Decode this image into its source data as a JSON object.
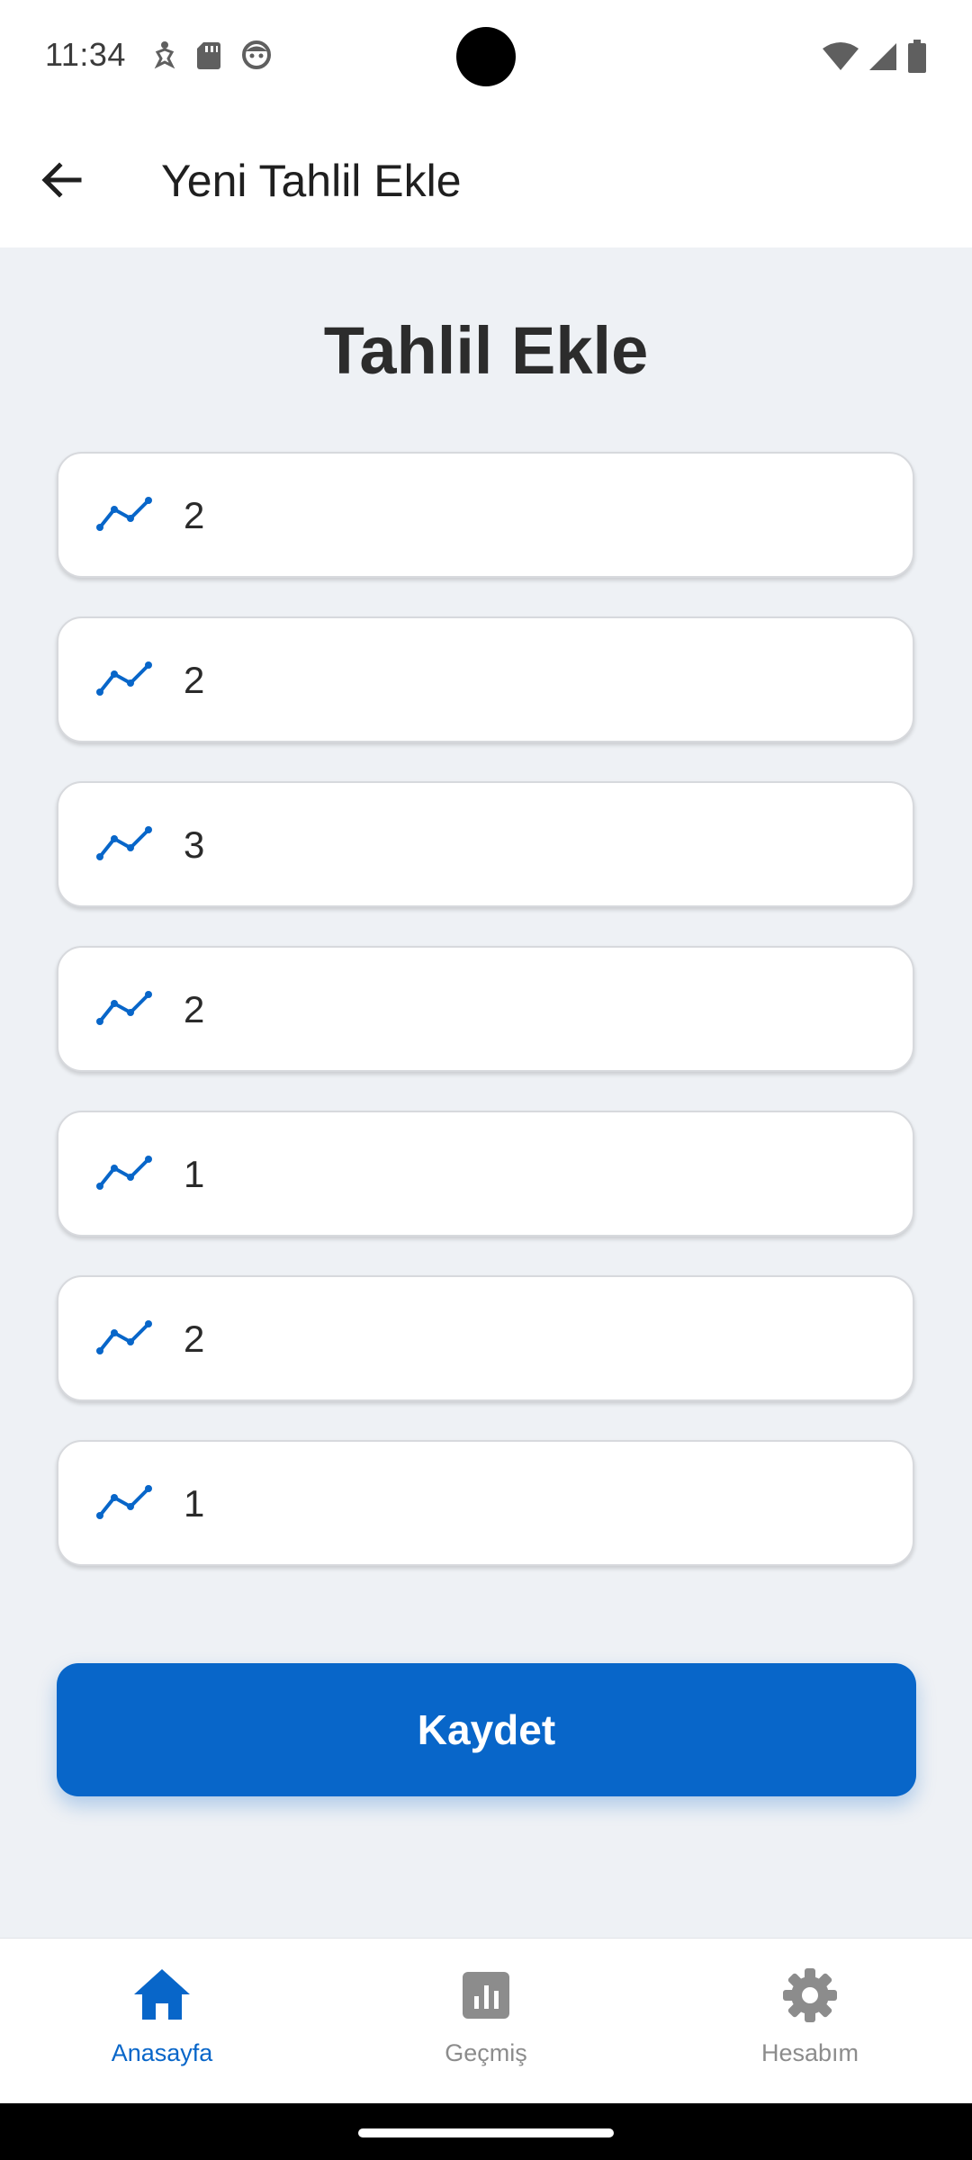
{
  "status_bar": {
    "time": "11:34",
    "left_icons": [
      "accessibility-icon",
      "sd-card-icon",
      "face-icon"
    ],
    "right_icons": [
      "wifi-icon",
      "signal-icon",
      "battery-icon"
    ]
  },
  "app_bar": {
    "title": "Yeni Tahlil Ekle",
    "back_icon": "arrow-back-icon"
  },
  "form": {
    "heading": "Tahlil Ekle",
    "fields": [
      {
        "value": "2",
        "icon": "trend-line-icon"
      },
      {
        "value": "2",
        "icon": "trend-line-icon"
      },
      {
        "value": "3",
        "icon": "trend-line-icon"
      },
      {
        "value": "2",
        "icon": "trend-line-icon"
      },
      {
        "value": "1",
        "icon": "trend-line-icon"
      },
      {
        "value": "2",
        "icon": "trend-line-icon"
      },
      {
        "value": "1",
        "icon": "trend-line-icon"
      }
    ],
    "save_label": "Kaydet"
  },
  "bottom_nav": {
    "items": [
      {
        "label": "Anasayfa",
        "icon": "home-icon",
        "active": true
      },
      {
        "label": "Geçmiş",
        "icon": "chart-icon",
        "active": false
      },
      {
        "label": "Hesabım",
        "icon": "settings-icon",
        "active": false
      }
    ]
  },
  "colors": {
    "accent": "#0866c9",
    "background": "#eef1f5",
    "inactive": "#8c8c8c"
  }
}
